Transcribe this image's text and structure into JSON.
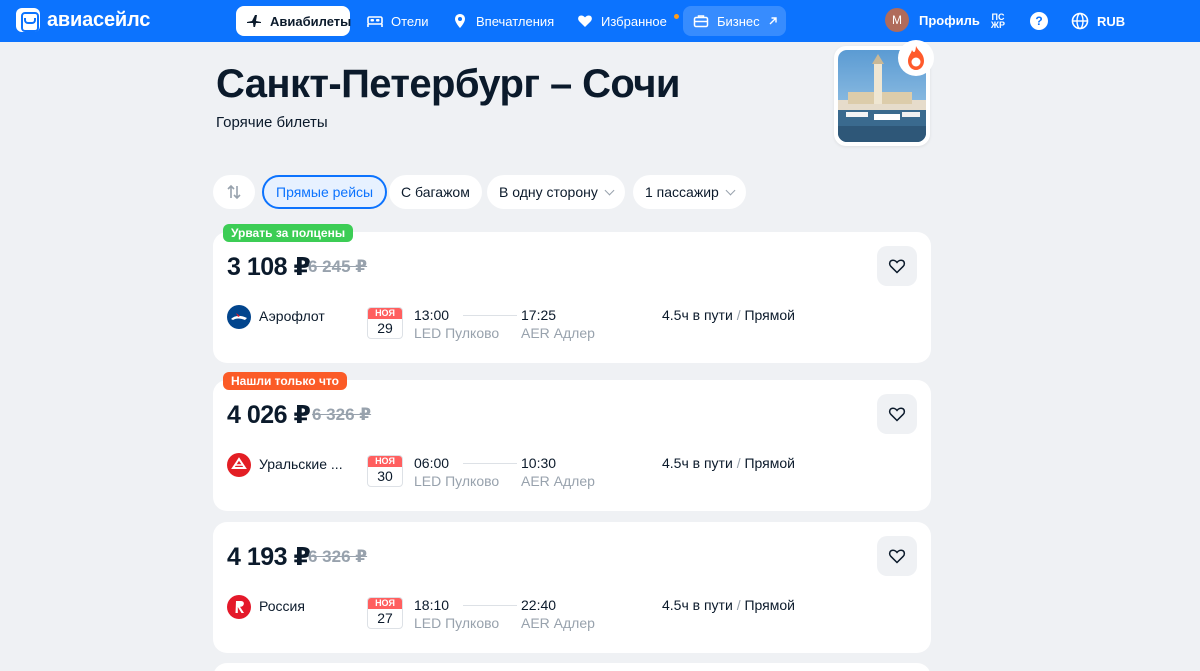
{
  "colors": {
    "brand": "#0c73fe",
    "green_badge": "#3ccd55",
    "orange_badge": "#fb5b27",
    "old_price": "#98a2ad"
  },
  "header": {
    "logo_text": "авиасейлс",
    "tabs": [
      {
        "label": "Авиабилеты",
        "icon": "plane-icon",
        "active": true
      },
      {
        "label": "Отели",
        "icon": "bed-icon"
      },
      {
        "label": "Впечатления",
        "icon": "pin-icon"
      },
      {
        "label": "Избранное",
        "icon": "heart-icon"
      },
      {
        "label": "Бизнес",
        "icon": "briefcase-icon"
      }
    ],
    "avatar_letter": "М",
    "profile_label": "Профиль",
    "psj_line1": "ПС",
    "psj_line2": "ЖР",
    "help_glyph": "?",
    "currency": "RUB"
  },
  "route": {
    "title": "Санкт-Петербург – Сочи",
    "subtitle": "Горячие билеты"
  },
  "filters": {
    "direct": "Прямые рейсы",
    "baggage": "С багажом",
    "trip_type": "В одну сторону",
    "passengers": "1 пассажир"
  },
  "tickets": [
    {
      "badge": "Урвать за полцены",
      "price": "3 108 ₽",
      "old_price": "6 245 ₽",
      "airline": "Аэрофлот",
      "month": "НОЯ",
      "day": "29",
      "dep_time": "13:00",
      "dep_airport": "LED Пулково",
      "arr_time": "17:25",
      "arr_airport": "AER Адлер",
      "duration": "4.5ч в пути",
      "stops": "Прямой"
    },
    {
      "badge": "Нашли только что",
      "price": "4 026 ₽",
      "old_price": "6 326 ₽",
      "airline": "Уральские ...",
      "month": "НОЯ",
      "day": "30",
      "dep_time": "06:00",
      "dep_airport": "LED Пулково",
      "arr_time": "10:30",
      "arr_airport": "AER Адлер",
      "duration": "4.5ч в пути",
      "stops": "Прямой"
    },
    {
      "price": "4 193 ₽",
      "old_price": "6 326 ₽",
      "airline": "Россия",
      "month": "НОЯ",
      "day": "27",
      "dep_time": "18:10",
      "dep_airport": "LED Пулково",
      "arr_time": "22:40",
      "arr_airport": "AER Адлер",
      "duration": "4.5ч в пути",
      "stops": "Прямой"
    }
  ],
  "divider": "/"
}
